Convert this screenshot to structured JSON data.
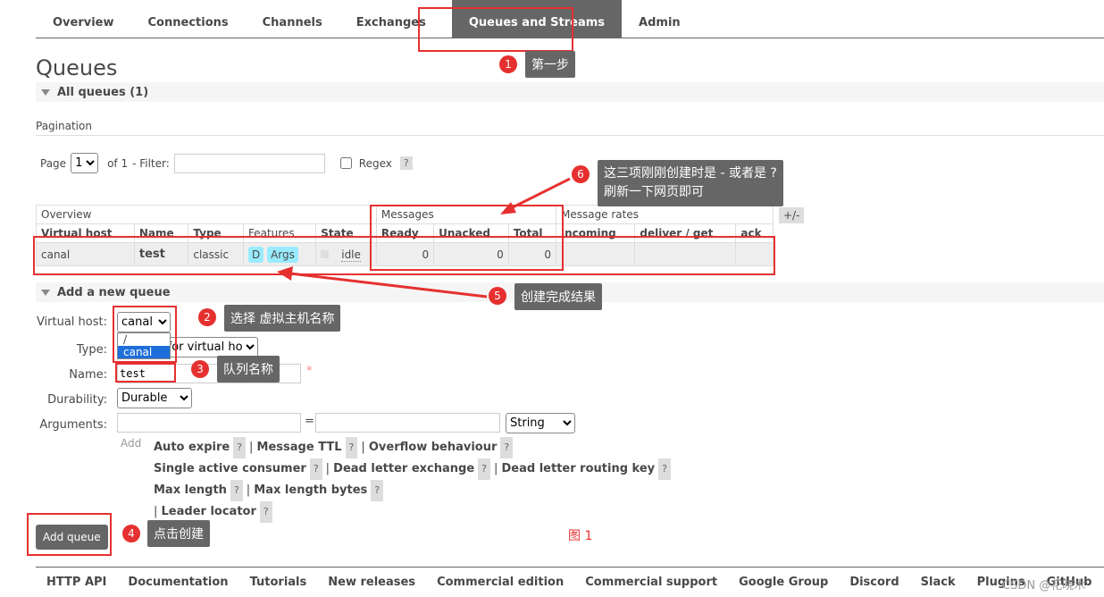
{
  "nav": [
    "Overview",
    "Connections",
    "Channels",
    "Exchanges",
    "Queues and Streams",
    "Admin"
  ],
  "page_title": "Queues",
  "all_queues": "All queues (1)",
  "pagination": {
    "label": "Pagination",
    "page_label": "Page",
    "page_value": "1",
    "of": "of 1",
    "filter_label": "- Filter:",
    "regex_label": "Regex",
    "help": "?"
  },
  "table": {
    "group_overview": "Overview",
    "group_messages": "Messages",
    "group_rates": "Message rates",
    "plusminus": "+/-",
    "headers": [
      "Virtual host",
      "Name",
      "Type",
      "Features",
      "State",
      "Ready",
      "Unacked",
      "Total",
      "incoming",
      "deliver / get",
      "ack"
    ],
    "row": {
      "vhost": "canal",
      "name": "test",
      "type": "classic",
      "feature_d": "D",
      "feature_args": "Args",
      "state": "idle",
      "ready": "0",
      "unacked": "0",
      "total": "0"
    }
  },
  "add": {
    "title": "Add a new queue",
    "vhost_label": "Virtual host:",
    "vhost_value": "canal",
    "vhost_options": [
      "/",
      "canal"
    ],
    "type_label": "Type:",
    "type_value": "Default for virtual host",
    "name_label": "Name:",
    "name_value": "test",
    "required": "*",
    "durability_label": "Durability:",
    "durability_value": "Durable",
    "arguments_label": "Arguments:",
    "eq": "=",
    "arg_type": "String",
    "add_label": "Add",
    "args": [
      [
        "Auto expire",
        "Message TTL",
        "Overflow behaviour"
      ],
      [
        "Single active consumer",
        "Dead letter exchange",
        "Dead letter routing key"
      ],
      [
        "Max length",
        "Max length bytes"
      ],
      [
        "Leader locator"
      ]
    ],
    "button": "Add queue"
  },
  "annotations": {
    "n1": "1",
    "c1": "第一步",
    "n2": "2",
    "c2": "选择 虚拟主机名称",
    "n3": "3",
    "c3": "队列名称",
    "n4": "4",
    "c4": "点击创建",
    "n5": "5",
    "c5": "创建完成结果",
    "n6": "6",
    "c6a": "这三项刚刚创建时是 - 或者是 ?",
    "c6b": "刷新一下网页即可",
    "fig": "图 1"
  },
  "footer": [
    "HTTP API",
    "Documentation",
    "Tutorials",
    "New releases",
    "Commercial edition",
    "Commercial support",
    "Google Group",
    "Discord",
    "Slack",
    "Plugins",
    "GitHub"
  ],
  "watermark": "CSDN @花晓木"
}
